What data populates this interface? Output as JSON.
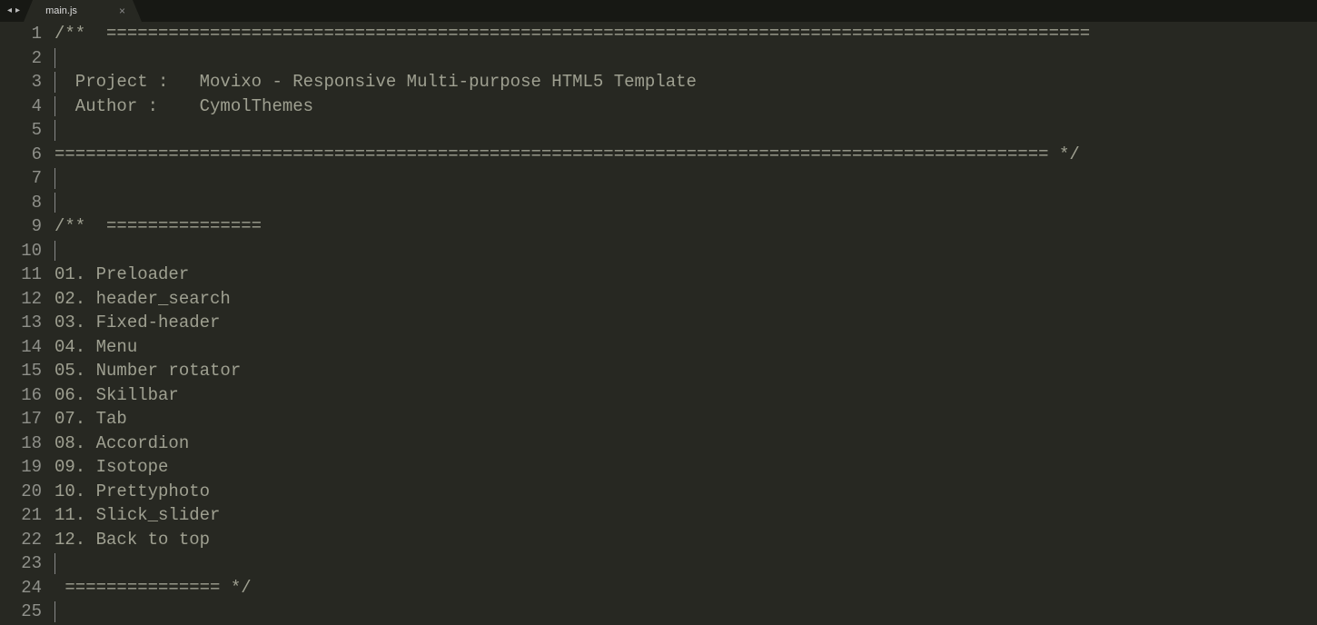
{
  "tab": {
    "filename": "main.js"
  },
  "nav": {
    "prev": "◂",
    "next": "▸"
  },
  "close_glyph": "×",
  "lines": [
    "/**  ===============================================================================================",
    "",
    "  Project :   Movixo - Responsive Multi-purpose HTML5 Template",
    "  Author :    CymolThemes",
    "",
    "================================================================================================ */",
    "",
    "",
    "/**  ===============",
    "",
    "01. Preloader",
    "02. header_search",
    "03. Fixed-header",
    "04. Menu",
    "05. Number rotator",
    "06. Skillbar",
    "07. Tab",
    "08. Accordion",
    "09. Isotope",
    "10. Prettyphoto",
    "11. Slick_slider",
    "12. Back to top",
    "",
    " =============== */",
    ""
  ],
  "caret_lines": [
    2,
    3,
    4,
    5,
    7,
    8,
    10,
    23,
    25
  ]
}
